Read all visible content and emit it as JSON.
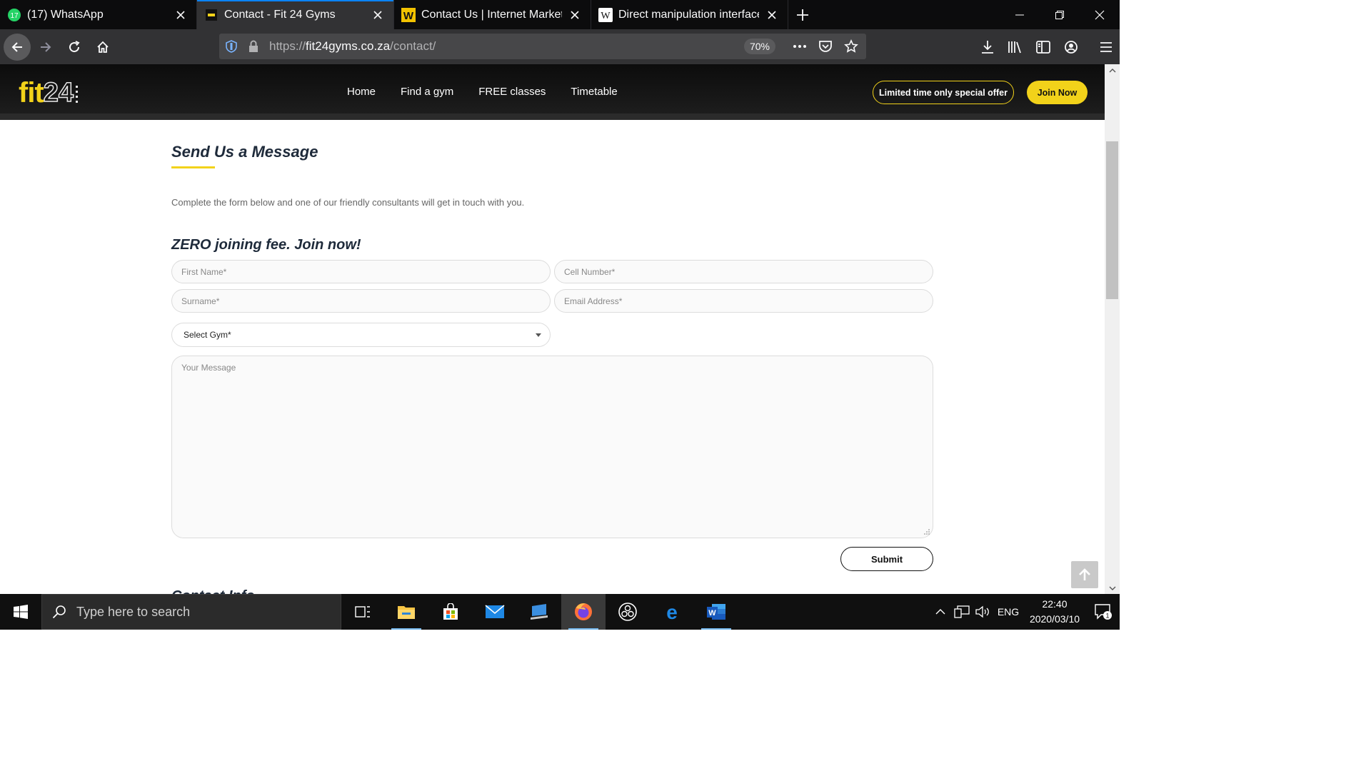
{
  "browser": {
    "tabs": [
      {
        "label": "(17) WhatsApp",
        "badge": "17",
        "active": false
      },
      {
        "label": "Contact - Fit 24 Gyms",
        "active": true
      },
      {
        "label": "Contact Us | Internet Marketing",
        "active": false
      },
      {
        "label": "Direct manipulation interface -",
        "active": false
      }
    ],
    "url_scheme": "https://",
    "url_host": "fit24gyms.co.za",
    "url_path": "/contact/",
    "zoom": "70%"
  },
  "site": {
    "logo_fit": "fit",
    "logo_num": "24",
    "menu": [
      "Home",
      "Find a gym",
      "FREE classes",
      "Timetable"
    ],
    "offer_label": "Limited time only special offer",
    "join_label": "Join Now",
    "accent": "#f2d21a"
  },
  "form": {
    "heading": "Send Us a Message",
    "intro": "Complete the form below and one of our friendly consultants will get in touch with you.",
    "subheading": "ZERO joining fee. Join now!",
    "first_name_placeholder": "First Name*",
    "cell_placeholder": "Cell Number*",
    "surname_placeholder": "Surname*",
    "email_placeholder": "Email Address*",
    "gym_select": "Select Gym*",
    "message_placeholder": "Your Message",
    "submit_label": "Submit",
    "next_section_peek": "Contact Info"
  },
  "taskbar": {
    "search_placeholder": "Type here to search",
    "language": "ENG",
    "time": "22:40",
    "date": "2020/03/10",
    "notifications": "1"
  }
}
